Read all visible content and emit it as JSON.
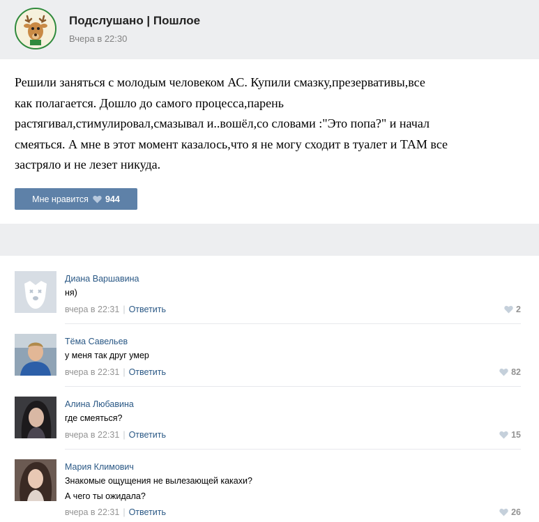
{
  "group": {
    "name": "Подслушано | Пошлое",
    "time": "Вчера в 22:30"
  },
  "post": {
    "lines": [
      "Решили заняться с молодым человеком АС. Купили смазку,презервативы,все",
      "как полагается. Дошло до самого процесса,парень",
      "растягивал,стимулировал,смазывал и..вошёл,со словами :\"Это попа?\" и начал",
      "смеяться. А мне в этот момент казалось,что я не могу сходит в туалет и ТАМ все",
      "застряло и не лезет никуда."
    ],
    "like_label": "Мне нравится",
    "like_count": "944"
  },
  "comments": [
    {
      "author": "Диана Варшавина",
      "lines": [
        "ня)"
      ],
      "time": "вчера в 22:31",
      "reply_label": "Ответить",
      "likes": "2",
      "avatar": "default-dog-avatar"
    },
    {
      "author": "Тёма Савельев",
      "lines": [
        "у меня так друг умер"
      ],
      "time": "вчера в 22:31",
      "reply_label": "Ответить",
      "likes": "82",
      "avatar": "photo-avatar"
    },
    {
      "author": "Алина Любавина",
      "lines": [
        "где смеяться?"
      ],
      "time": "вчера в 22:31",
      "reply_label": "Ответить",
      "likes": "15",
      "avatar": "photo-avatar"
    },
    {
      "author": "Мария Климович",
      "lines": [
        "Знакомые ощущения не вылезающей какахи?",
        "А чего ты ожидала?"
      ],
      "time": "вчера в 22:31",
      "reply_label": "Ответить",
      "likes": "26",
      "avatar": "photo-avatar"
    }
  ],
  "colors": {
    "link": "#2a5885",
    "button": "#5e81a8",
    "band": "#edeef0"
  }
}
